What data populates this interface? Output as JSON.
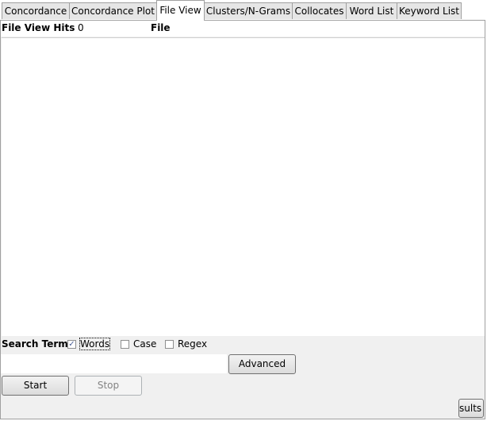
{
  "tabs": [
    {
      "label": "Concordance"
    },
    {
      "label": "Concordance Plot"
    },
    {
      "label": "File View",
      "selected": true
    },
    {
      "label": "Clusters/N-Grams"
    },
    {
      "label": "Collocates"
    },
    {
      "label": "Word List"
    },
    {
      "label": "Keyword List"
    }
  ],
  "header": {
    "hits_label": "File View Hits",
    "hits_value": "0",
    "file_label": "File"
  },
  "search": {
    "label": "Search Term",
    "words": {
      "label": "Words",
      "checked": true
    },
    "case": {
      "label": "Case",
      "checked": false
    },
    "regex": {
      "label": "Regex",
      "checked": false
    },
    "value": "",
    "advanced_label": "Advanced"
  },
  "buttons": {
    "start": "Start",
    "stop": "Stop",
    "results": "sults"
  },
  "icons": {
    "checkmark": "✓"
  }
}
